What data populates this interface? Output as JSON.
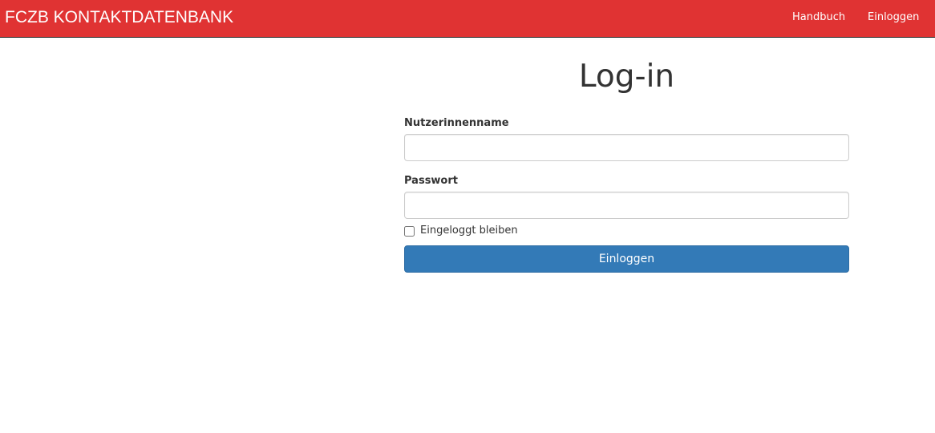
{
  "navbar": {
    "brand": "FCZB KONTAKTDATENBANK",
    "links": [
      {
        "label": "Handbuch"
      },
      {
        "label": "Einloggen"
      }
    ],
    "background_color": "#e03333"
  },
  "login": {
    "title": "Log-in",
    "username_label": "Nutzerinnenname",
    "username_value": "",
    "password_label": "Passwort",
    "password_value": "",
    "remember_label": "Eingeloggt bleiben",
    "remember_checked": false,
    "submit_label": "Einloggen",
    "submit_color": "#337ab7"
  }
}
